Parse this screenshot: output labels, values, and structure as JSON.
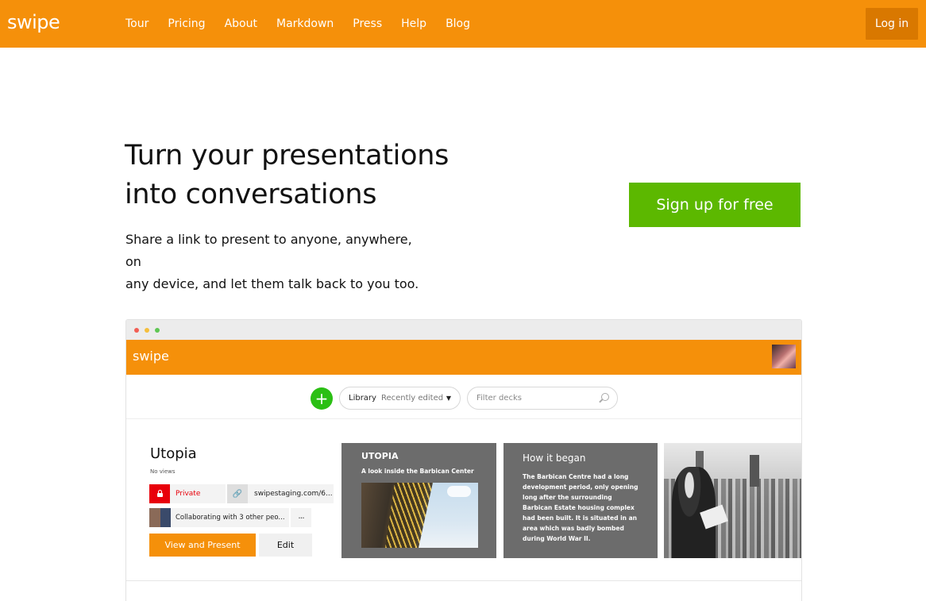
{
  "header": {
    "logo": "swipe",
    "nav": [
      "Tour",
      "Pricing",
      "About",
      "Markdown",
      "Press",
      "Help",
      "Blog"
    ],
    "login_label": "Log in",
    "brand_color": "#f5900a"
  },
  "hero": {
    "title_line1": "Turn your presentations",
    "title_line2": "into conversations",
    "subtitle_line1": "Share a link to present to anyone, anywhere, on",
    "subtitle_line2": "any device, and let them talk back to you too.",
    "signup_label": "Sign up for free",
    "signup_color": "#5cb800"
  },
  "mockup": {
    "logo": "swipe",
    "toolbar": {
      "add_label": "+",
      "library_label": "Library",
      "library_value": "Recently edited",
      "filter_placeholder": "Filter decks"
    },
    "deck": {
      "title": "Utopia",
      "views": "No views",
      "privacy_label": "Private",
      "link_label": "swipestaging.com/6...",
      "collab_label": "Collaborating with 3 other peo...",
      "more_label": "···",
      "view_label": "View and Present",
      "edit_label": "Edit"
    },
    "slides": [
      {
        "title": "UTOPIA",
        "subtitle": "A look inside the Barbican Center"
      },
      {
        "title": "How it began",
        "body": "The Barbican Centre had a long development period, only opening long after the surrounding Barbican Estate housing complex had been built. It is situated in an area which was badly bombed during World War II."
      }
    ]
  }
}
